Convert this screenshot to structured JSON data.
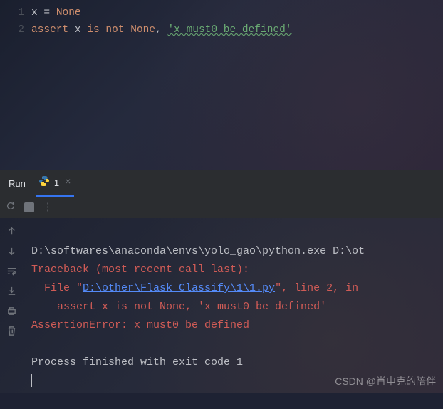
{
  "editor": {
    "gutter": [
      "1",
      "2"
    ],
    "line1": {
      "ident": "x ",
      "op": "= ",
      "const": "None"
    },
    "line2": {
      "kw1": "assert ",
      "ident": "x ",
      "kw2": "is not ",
      "const": "None",
      "comma": ", ",
      "str": "'x must0 be defined'"
    }
  },
  "panel": {
    "title": "Run",
    "tab_label": "1",
    "tab_close": "×"
  },
  "toolbar": {
    "dots": "⋮"
  },
  "console": {
    "cmd": "D:\\softwares\\anaconda\\envs\\yolo_gao\\python.exe D:\\ot",
    "traceback": "Traceback (most recent call last):",
    "file_prefix": "  File \"",
    "file_path": "D:\\other\\Flask_Classify\\1\\1.py",
    "file_suffix": "\", line 2, in ",
    "assert_line": "    assert x is not None, 'x must0 be defined'",
    "error_line": "AssertionError: x must0 be defined",
    "exit_line": "Process finished with exit code 1"
  },
  "watermark": "CSDN @肖申克的陪伴"
}
